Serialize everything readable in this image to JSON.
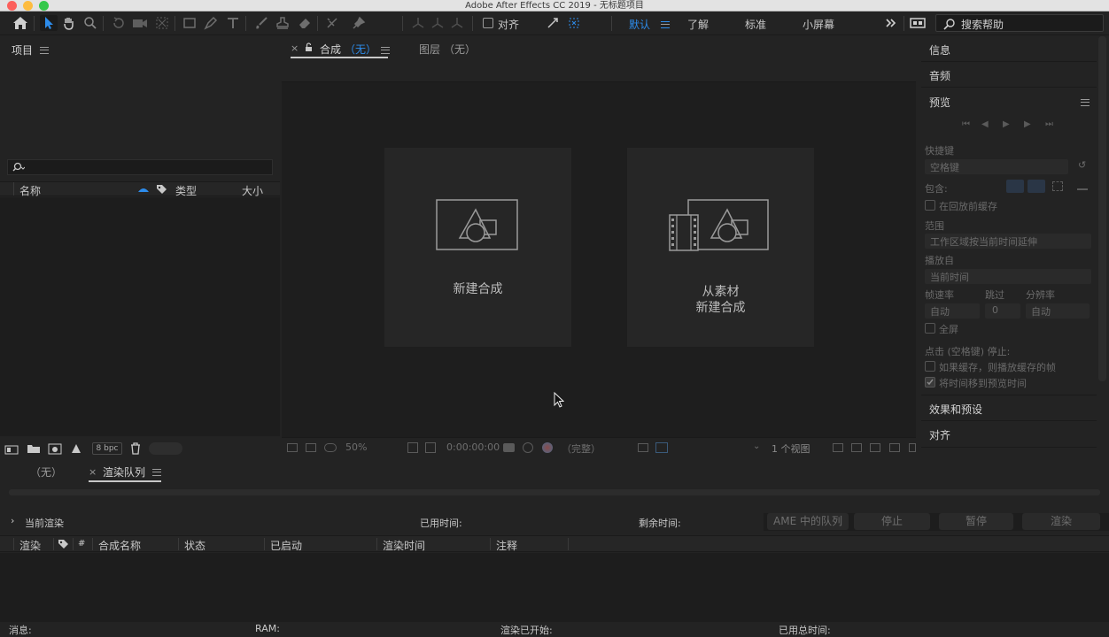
{
  "window": {
    "title": "Adobe After Effects CC 2019 - 无标题项目"
  },
  "toolbar": {
    "align_label": "对齐",
    "workspaces": [
      "默认",
      "了解",
      "标准",
      "小屏幕"
    ],
    "search_label": "搜索帮助"
  },
  "project_panel": {
    "title": "项目",
    "columns": {
      "name": "名称",
      "type": "类型",
      "size": "大小"
    },
    "bit_depth": "8 bpc"
  },
  "viewer": {
    "comp_tab_label": "合成",
    "comp_tab_value": "（无）",
    "layer_tab_label": "图层",
    "layer_tab_value": "（无）",
    "new_comp_label": "新建合成",
    "from_footage_line1": "从素材",
    "from_footage_line2": "新建合成",
    "zoom": "50%",
    "timecode": "0:00:00:00",
    "resolution": "（完整）",
    "views": "1 个视图"
  },
  "right_panel": {
    "info": "信息",
    "audio": "音频",
    "preview": "预览",
    "shortcut_label": "快捷键",
    "shortcut_value": "空格键",
    "include_label": "包含:",
    "cache_before_playback": "在回放前缓存",
    "range_label": "范围",
    "range_value": "工作区域按当前时间延伸",
    "play_from_label": "播放自",
    "play_from_value": "当前时间",
    "frame_rate_label": "帧速率",
    "skip_label": "跳过",
    "resolution_label": "分辨率",
    "frame_rate_value": "自动",
    "skip_value": "0",
    "resolution_value": "自动",
    "fullscreen": "全屏",
    "on_stop_label": "点击 (空格键) 停止:",
    "if_cached": "如果缓存，则播放缓存的帧",
    "move_time": "将时间移到预览时间",
    "effects": "效果和预设",
    "align": "对齐"
  },
  "render_queue": {
    "tab_none": "（无）",
    "tab_title": "渲染队列",
    "current_render": "当前渲染",
    "elapsed": "已用时间:",
    "remaining": "剩余时间:",
    "buttons": [
      "AME 中的队列",
      "停止",
      "暂停",
      "渲染"
    ],
    "columns": [
      "渲染",
      "#",
      "合成名称",
      "状态",
      "已启动",
      "渲染时间",
      "注释"
    ],
    "footer": {
      "messages": "消息:",
      "ram": "RAM:",
      "render_started": "渲染已开始:",
      "total_elapsed": "已用总时间:"
    }
  },
  "colors": {
    "accent": "#2d8ceb",
    "background": "#232323"
  }
}
